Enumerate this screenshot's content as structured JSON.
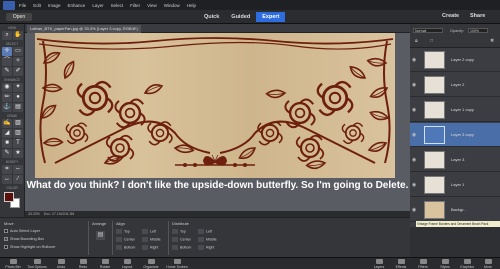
{
  "menubar": {
    "items": [
      "File",
      "Edit",
      "Image",
      "Enhance",
      "Layer",
      "Select",
      "Filter",
      "View",
      "Window",
      "Help"
    ]
  },
  "modebar": {
    "open_label": "Open",
    "modes": [
      "Quick",
      "Guided",
      "Expert"
    ],
    "active_mode": "Expert",
    "create_label": "Create",
    "share_label": "Share"
  },
  "document_tab": {
    "label": "Lathan_BTK_paperFan.jpg @ 33.3% (Layer 3 copy, RGB/8*)"
  },
  "toolbar": {
    "sections": [
      "VIEW",
      "SELECT",
      "ENHANCE",
      "DRAW",
      "MODIFY",
      "COLOR"
    ],
    "fg_color": "#5b0f0b",
    "bg_color": "#ffffff"
  },
  "canvas": {
    "caption": "What do you think? I don't like the upside-down butterfly. So I'm going to Delete.",
    "paper_color": "#d4bc93",
    "ornament_color": "#6e1f0e"
  },
  "statusbar": {
    "zoom": "33.33%",
    "doc": "Doc: 27.1M/204.3M"
  },
  "layers_panel": {
    "blend_mode": "Normal",
    "opacity_label": "Opacity:",
    "opacity_value": "100%",
    "layers": [
      {
        "name": "Layer 2 copy",
        "thumb": "ornament"
      },
      {
        "name": "Layer 2",
        "thumb": "ornament"
      },
      {
        "name": "Layer 1 copy",
        "thumb": "ornament"
      },
      {
        "name": "Layer 3 copy",
        "thumb": "selected"
      },
      {
        "name": "Layer 3",
        "thumb": "ornament"
      },
      {
        "name": "Layer 1",
        "thumb": "ornament"
      },
      {
        "name": "Backgr...",
        "thumb": "paper"
      }
    ],
    "active_layer": "Layer 3 copy",
    "tooltip": "Vintage Frame Borders and Ornament Brush Pack"
  },
  "tool_options": {
    "move_label": "Move",
    "auto_select": "Auto Select Layer",
    "show_bbox": "Show Bounding Box",
    "show_highlight": "Show Highlight on Rollover",
    "arrange_label": "Arrange",
    "align_label": "Align",
    "distribute_label": "Distribute",
    "align_buttons": [
      "Top",
      "Center",
      "Bottom",
      "Left",
      "Middle",
      "Right"
    ],
    "distribute_buttons": [
      "Top",
      "Center",
      "Bottom",
      "Left",
      "Middle",
      "Right"
    ]
  },
  "bottombar": {
    "left": [
      "Photo Bin",
      "Tool Options",
      "Undo",
      "Redo",
      "Rotate",
      "Layout",
      "Organizer",
      "Home Screen"
    ],
    "right": [
      "Layers",
      "Effects",
      "Filters",
      "Styles",
      "Graphics",
      "More"
    ]
  }
}
